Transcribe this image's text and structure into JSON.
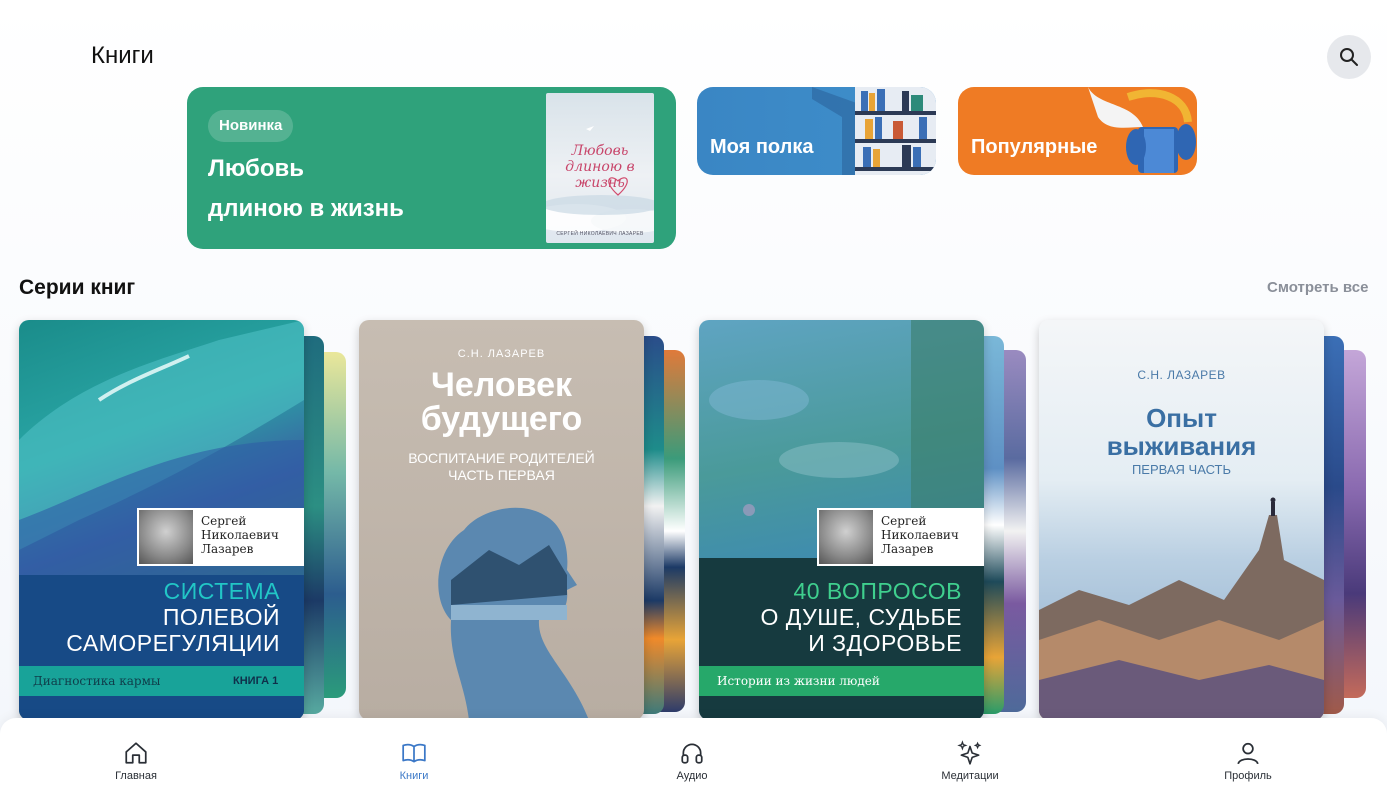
{
  "header": {
    "title": "Книги",
    "search_icon": "search-icon"
  },
  "hero": {
    "badge": "Новинка",
    "title_line1": "Любовь",
    "title_line2": "длиною в жизнь",
    "cover_title": "Любовь длиною в жизнь",
    "cover_author": "СЕРГЕЙ НИКОЛАЕВИЧ ЛАЗАРЕВ",
    "color": "#2fa27b"
  },
  "tiles": [
    {
      "label": "Моя полка",
      "color": "#3a86c4"
    },
    {
      "label": "Популярные",
      "color": "#ef7b24"
    }
  ],
  "series_section": {
    "title": "Серии книг",
    "see_all": "Смотреть все"
  },
  "books": [
    {
      "author_line1": "Сергей",
      "author_line2": "Николаевич",
      "author_line3": "Лазарев",
      "title_line1": "СИСТЕМА",
      "title_line2": "ПОЛЕВОЙ",
      "title_line3": "САМОРЕГУЛЯЦИИ",
      "subtitle": "Диагностика кармы",
      "volume": "КНИГА 1"
    },
    {
      "author": "С.Н. ЛАЗАРЕВ",
      "title_line1": "Человек",
      "title_line2": "будущего",
      "subtitle_line1": "ВОСПИТАНИЕ РОДИТЕЛЕЙ",
      "subtitle_line2": "ЧАСТЬ ПЕРВАЯ"
    },
    {
      "author_line1": "Сергей",
      "author_line2": "Николаевич",
      "author_line3": "Лазарев",
      "title_line1": "40 ВОПРОСОВ",
      "title_line2": "О ДУШЕ, СУДЬБЕ",
      "title_line3": "И ЗДОРОВЬЕ",
      "subtitle": "Истории из жизни людей"
    },
    {
      "author": "С.Н. ЛАЗАРЕВ",
      "title_line1": "Опыт",
      "title_line2": "выживания",
      "subtitle": "ПЕРВАЯ ЧАСТЬ"
    }
  ],
  "nav": [
    {
      "label": "Главная",
      "icon": "home-icon",
      "active": false
    },
    {
      "label": "Книги",
      "icon": "book-icon",
      "active": true
    },
    {
      "label": "Аудио",
      "icon": "headphones-icon",
      "active": false
    },
    {
      "label": "Медитации",
      "icon": "sparkles-icon",
      "active": false
    },
    {
      "label": "Профиль",
      "icon": "user-icon",
      "active": false
    }
  ],
  "colors": {
    "accent": "#3b78c7",
    "hero": "#2fa27b",
    "shelf": "#3a86c4",
    "popular": "#ef7b24"
  }
}
